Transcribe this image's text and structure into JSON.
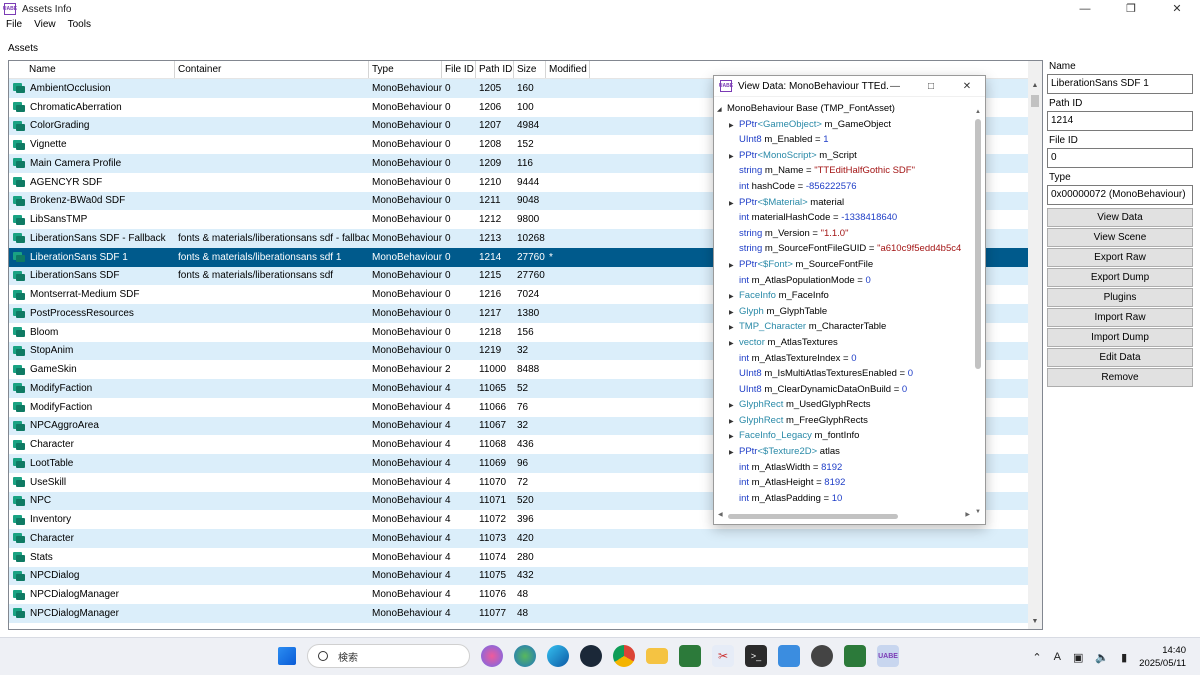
{
  "window": {
    "title": "Assets Info",
    "icon_text": "UABE"
  },
  "menu": [
    "File",
    "View",
    "Tools"
  ],
  "assets_label": "Assets",
  "columns": [
    "Name",
    "Container",
    "Type",
    "File ID",
    "Path ID",
    "Size",
    "Modified"
  ],
  "rows": [
    {
      "name": "AmbientOcclusion",
      "container": "",
      "type": "MonoBehaviour",
      "fid": "0",
      "pid": "1205",
      "size": "160",
      "mod": ""
    },
    {
      "name": "ChromaticAberration",
      "container": "",
      "type": "MonoBehaviour",
      "fid": "0",
      "pid": "1206",
      "size": "100",
      "mod": ""
    },
    {
      "name": "ColorGrading",
      "container": "",
      "type": "MonoBehaviour",
      "fid": "0",
      "pid": "1207",
      "size": "4984",
      "mod": ""
    },
    {
      "name": "Vignette",
      "container": "",
      "type": "MonoBehaviour",
      "fid": "0",
      "pid": "1208",
      "size": "152",
      "mod": ""
    },
    {
      "name": "Main Camera Profile",
      "container": "",
      "type": "MonoBehaviour",
      "fid": "0",
      "pid": "1209",
      "size": "116",
      "mod": ""
    },
    {
      "name": "AGENCYR SDF",
      "container": "",
      "type": "MonoBehaviour",
      "fid": "0",
      "pid": "1210",
      "size": "9444",
      "mod": ""
    },
    {
      "name": "Brokenz-BWa0d SDF",
      "container": "",
      "type": "MonoBehaviour",
      "fid": "0",
      "pid": "1211",
      "size": "9048",
      "mod": ""
    },
    {
      "name": "LibSansTMP",
      "container": "",
      "type": "MonoBehaviour",
      "fid": "0",
      "pid": "1212",
      "size": "9800",
      "mod": ""
    },
    {
      "name": "LiberationSans SDF - Fallback",
      "container": "fonts & materials/liberationsans sdf - fallback",
      "type": "MonoBehaviour",
      "fid": "0",
      "pid": "1213",
      "size": "10268",
      "mod": ""
    },
    {
      "name": "LiberationSans SDF 1",
      "container": "fonts & materials/liberationsans sdf 1",
      "type": "MonoBehaviour",
      "fid": "0",
      "pid": "1214",
      "size": "27760",
      "mod": "*",
      "selected": true
    },
    {
      "name": "LiberationSans SDF",
      "container": "fonts & materials/liberationsans sdf",
      "type": "MonoBehaviour",
      "fid": "0",
      "pid": "1215",
      "size": "27760",
      "mod": ""
    },
    {
      "name": "Montserrat-Medium SDF",
      "container": "",
      "type": "MonoBehaviour",
      "fid": "0",
      "pid": "1216",
      "size": "7024",
      "mod": ""
    },
    {
      "name": "PostProcessResources",
      "container": "",
      "type": "MonoBehaviour",
      "fid": "0",
      "pid": "1217",
      "size": "1380",
      "mod": ""
    },
    {
      "name": "Bloom",
      "container": "",
      "type": "MonoBehaviour",
      "fid": "0",
      "pid": "1218",
      "size": "156",
      "mod": ""
    },
    {
      "name": "StopAnim",
      "container": "",
      "type": "MonoBehaviour",
      "fid": "0",
      "pid": "1219",
      "size": "32",
      "mod": ""
    },
    {
      "name": "GameSkin",
      "container": "",
      "type": "MonoBehaviour",
      "fid": "2",
      "pid": "11000",
      "size": "8488",
      "mod": ""
    },
    {
      "name": "ModifyFaction",
      "container": "",
      "type": "MonoBehaviour",
      "fid": "4",
      "pid": "11065",
      "size": "52",
      "mod": ""
    },
    {
      "name": "ModifyFaction",
      "container": "",
      "type": "MonoBehaviour",
      "fid": "4",
      "pid": "11066",
      "size": "76",
      "mod": ""
    },
    {
      "name": "NPCAggroArea",
      "container": "",
      "type": "MonoBehaviour",
      "fid": "4",
      "pid": "11067",
      "size": "32",
      "mod": ""
    },
    {
      "name": "Character",
      "container": "",
      "type": "MonoBehaviour",
      "fid": "4",
      "pid": "11068",
      "size": "436",
      "mod": ""
    },
    {
      "name": "LootTable",
      "container": "",
      "type": "MonoBehaviour",
      "fid": "4",
      "pid": "11069",
      "size": "96",
      "mod": ""
    },
    {
      "name": "UseSkill",
      "container": "",
      "type": "MonoBehaviour",
      "fid": "4",
      "pid": "11070",
      "size": "72",
      "mod": ""
    },
    {
      "name": "NPC",
      "container": "",
      "type": "MonoBehaviour",
      "fid": "4",
      "pid": "11071",
      "size": "520",
      "mod": ""
    },
    {
      "name": "Inventory",
      "container": "",
      "type": "MonoBehaviour",
      "fid": "4",
      "pid": "11072",
      "size": "396",
      "mod": ""
    },
    {
      "name": "Character",
      "container": "",
      "type": "MonoBehaviour",
      "fid": "4",
      "pid": "11073",
      "size": "420",
      "mod": ""
    },
    {
      "name": "Stats",
      "container": "",
      "type": "MonoBehaviour",
      "fid": "4",
      "pid": "11074",
      "size": "280",
      "mod": ""
    },
    {
      "name": "NPCDialog",
      "container": "",
      "type": "MonoBehaviour",
      "fid": "4",
      "pid": "11075",
      "size": "432",
      "mod": ""
    },
    {
      "name": "NPCDialogManager",
      "container": "",
      "type": "MonoBehaviour",
      "fid": "4",
      "pid": "11076",
      "size": "48",
      "mod": ""
    },
    {
      "name": "NPCDialogManager",
      "container": "",
      "type": "MonoBehaviour",
      "fid": "4",
      "pid": "11077",
      "size": "48",
      "mod": ""
    }
  ],
  "panel": {
    "name_label": "Name",
    "name_value": "LiberationSans SDF 1",
    "pathid_label": "Path ID",
    "pathid_value": "1214",
    "fileid_label": "File ID",
    "fileid_value": "0",
    "type_label": "Type",
    "type_value": "0x00000072 (MonoBehaviour)",
    "buttons": [
      "View Data",
      "View Scene",
      "Export Raw",
      "Export Dump",
      "Plugins",
      "Import Raw",
      "Import Dump",
      "Edit Data",
      "Remove"
    ]
  },
  "viewdata": {
    "title": "View Data: MonoBehaviour TTEd...",
    "root": "MonoBehaviour Base (TMP_FontAsset)",
    "nodes": [
      {
        "arrow": true,
        "t": "PPtr",
        "g": "<GameObject>",
        "n": " m_GameObject",
        "v": "",
        "vc": ""
      },
      {
        "arrow": false,
        "t": "UInt8",
        "g": "",
        "n": " m_Enabled = ",
        "v": "1",
        "vc": "num"
      },
      {
        "arrow": true,
        "t": "PPtr",
        "g": "<MonoScript>",
        "n": " m_Script",
        "v": "",
        "vc": ""
      },
      {
        "arrow": false,
        "t": "string",
        "g": "",
        "n": " m_Name = ",
        "v": "\"TTEditHalfGothic SDF\"",
        "vc": "str"
      },
      {
        "arrow": false,
        "t": "int",
        "g": "",
        "n": " hashCode = ",
        "v": "-856222576",
        "vc": "num"
      },
      {
        "arrow": true,
        "t": "PPtr",
        "g": "<$Material>",
        "n": " material",
        "v": "",
        "vc": ""
      },
      {
        "arrow": false,
        "t": "int",
        "g": "",
        "n": " materialHashCode = ",
        "v": "-1338418640",
        "vc": "num"
      },
      {
        "arrow": false,
        "t": "string",
        "g": "",
        "n": " m_Version = ",
        "v": "\"1.1.0\"",
        "vc": "str"
      },
      {
        "arrow": false,
        "t": "string",
        "g": "",
        "n": " m_SourceFontFileGUID = ",
        "v": "\"a610c9f5edd4b5c4",
        "vc": "str"
      },
      {
        "arrow": true,
        "t": "PPtr",
        "g": "<$Font>",
        "n": " m_SourceFontFile",
        "v": "",
        "vc": ""
      },
      {
        "arrow": false,
        "t": "int",
        "g": "",
        "n": " m_AtlasPopulationMode = ",
        "v": "0",
        "vc": "num"
      },
      {
        "arrow": true,
        "t": "",
        "g": "FaceInfo",
        "n": " m_FaceInfo",
        "v": "",
        "vc": ""
      },
      {
        "arrow": true,
        "t": "",
        "g": "Glyph",
        "n": " m_GlyphTable",
        "v": "",
        "vc": ""
      },
      {
        "arrow": true,
        "t": "",
        "g": "TMP_Character",
        "n": " m_CharacterTable",
        "v": "",
        "vc": ""
      },
      {
        "arrow": true,
        "t": "",
        "g": "vector",
        "n": " m_AtlasTextures",
        "v": "",
        "vc": ""
      },
      {
        "arrow": false,
        "t": "int",
        "g": "",
        "n": " m_AtlasTextureIndex = ",
        "v": "0",
        "vc": "num"
      },
      {
        "arrow": false,
        "t": "UInt8",
        "g": "",
        "n": " m_IsMultiAtlasTexturesEnabled = ",
        "v": "0",
        "vc": "num"
      },
      {
        "arrow": false,
        "t": "UInt8",
        "g": "",
        "n": " m_ClearDynamicDataOnBuild = ",
        "v": "0",
        "vc": "num"
      },
      {
        "arrow": true,
        "t": "",
        "g": "GlyphRect",
        "n": " m_UsedGlyphRects",
        "v": "",
        "vc": ""
      },
      {
        "arrow": true,
        "t": "",
        "g": "GlyphRect",
        "n": " m_FreeGlyphRects",
        "v": "",
        "vc": ""
      },
      {
        "arrow": true,
        "t": "",
        "g": "FaceInfo_Legacy",
        "n": " m_fontInfo",
        "v": "",
        "vc": ""
      },
      {
        "arrow": true,
        "t": "PPtr",
        "g": "<$Texture2D>",
        "n": " atlas",
        "v": "",
        "vc": ""
      },
      {
        "arrow": false,
        "t": "int",
        "g": "",
        "n": " m_AtlasWidth = ",
        "v": "8192",
        "vc": "num"
      },
      {
        "arrow": false,
        "t": "int",
        "g": "",
        "n": " m_AtlasHeight = ",
        "v": "8192",
        "vc": "num"
      },
      {
        "arrow": false,
        "t": "int",
        "g": "",
        "n": " m_AtlasPadding = ",
        "v": "10",
        "vc": "num"
      }
    ]
  },
  "taskbar": {
    "search_placeholder": "検索",
    "time": "14:40",
    "date": "2025/05/11",
    "ime": "A"
  }
}
